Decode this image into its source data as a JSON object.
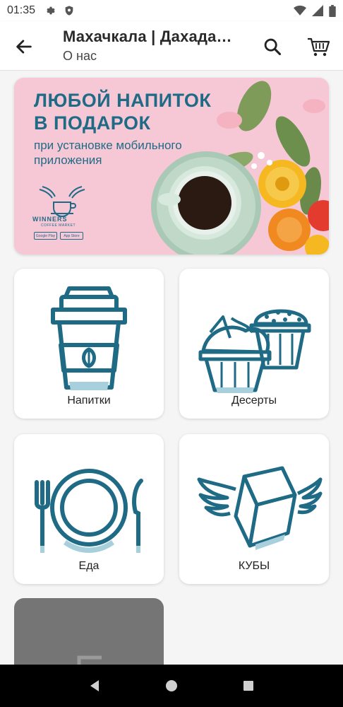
{
  "status_bar": {
    "time": "01:35"
  },
  "app_bar": {
    "title": "Махачкала | Дахадаева",
    "subtitle": "О нас"
  },
  "banner": {
    "headline_line1": "ЛЮБОЙ НАПИТОК",
    "headline_line2": "В ПОДАРОК",
    "subline": "при установке мобильного приложения",
    "brand": "WINNERS",
    "brand_sub": "COFFEE MARKET",
    "badge_google": "Google Play",
    "badge_apple": "App Store"
  },
  "categories": [
    {
      "label": "Напитки",
      "icon": "coffee-cup-icon"
    },
    {
      "label": "Десерты",
      "icon": "cupcakes-icon"
    },
    {
      "label": "Еда",
      "icon": "plate-cutlery-icon"
    },
    {
      "label": "КУБЫ",
      "icon": "winged-cube-icon"
    }
  ],
  "colors": {
    "accent": "#1f6b86",
    "banner_bg": "#f6c8d6"
  }
}
